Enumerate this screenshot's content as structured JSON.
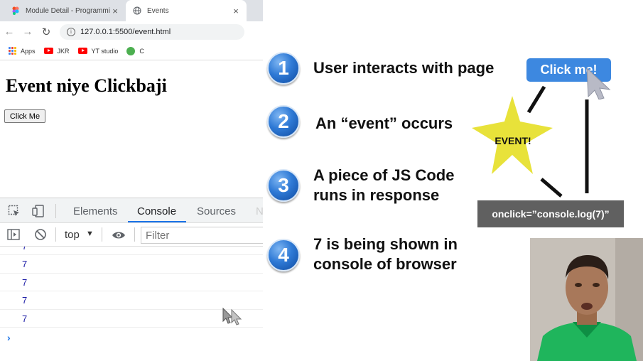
{
  "browser": {
    "tabs": [
      {
        "title": "Module Detail - Programming",
        "active": false
      },
      {
        "title": "Events",
        "active": true
      }
    ],
    "url": "127.0.0.1:5500/event.html",
    "bookmarks": [
      {
        "label": "Apps",
        "icon": "apps-grid-icon"
      },
      {
        "label": "JKR",
        "icon": "youtube-icon"
      },
      {
        "label": "YT studio",
        "icon": "youtube-icon"
      },
      {
        "label": "C",
        "icon": "github-icon"
      }
    ]
  },
  "page": {
    "heading": "Event niye Clickbaji",
    "button_label": "Click Me"
  },
  "devtools": {
    "tabs": [
      "Elements",
      "Console",
      "Sources",
      "Ne"
    ],
    "active_tab": "Console",
    "context": "top",
    "filter_placeholder": "Filter",
    "logs": [
      "7",
      "7",
      "7",
      "7",
      "7"
    ],
    "prompt": "›"
  },
  "slide": {
    "steps": [
      {
        "num": "1",
        "lines": [
          "User interacts with page"
        ]
      },
      {
        "num": "2",
        "lines": [
          "An “event” occurs"
        ]
      },
      {
        "num": "3",
        "lines": [
          "A piece of JS Code",
          "runs in response"
        ]
      },
      {
        "num": "4",
        "lines": [
          "7 is being shown in",
          "console of browser"
        ]
      }
    ],
    "demo_button": "Click me!",
    "star_label": "EVENT!",
    "code_box": "onclick=”console.log(7)”"
  },
  "colors": {
    "accent_blue": "#3d88e0",
    "star_yellow": "#e8e23a",
    "code_box_bg": "#606060",
    "devtools_active": "#1a73e8",
    "console_value": "#1a1aa6"
  }
}
